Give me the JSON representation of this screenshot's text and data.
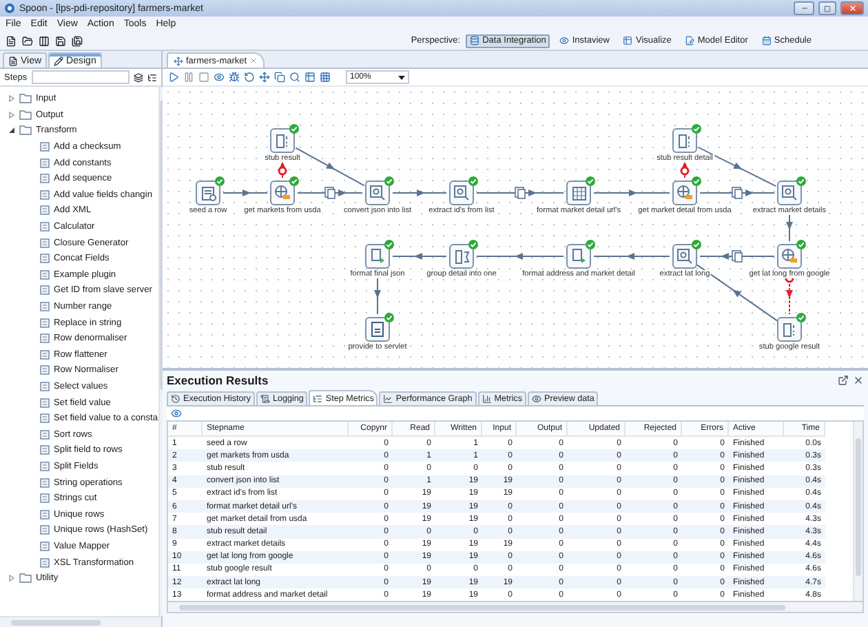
{
  "window": {
    "title": "Spoon - [lps-pdi-repository] farmers-market"
  },
  "menu": [
    "File",
    "Edit",
    "View",
    "Action",
    "Tools",
    "Help"
  ],
  "perspective": {
    "label": "Perspective:",
    "items": [
      {
        "label": "Data Integration",
        "selected": true
      },
      {
        "label": "Instaview",
        "selected": false
      },
      {
        "label": "Visualize",
        "selected": false
      },
      {
        "label": "Model Editor",
        "selected": false
      },
      {
        "label": "Schedule",
        "selected": false
      }
    ]
  },
  "left_tabs": [
    {
      "label": "View",
      "selected": false
    },
    {
      "label": "Design",
      "selected": true
    }
  ],
  "steps_search": {
    "label": "Steps"
  },
  "tree": [
    {
      "label": "Input",
      "expanded": false
    },
    {
      "label": "Output",
      "expanded": false
    },
    {
      "label": "Transform",
      "expanded": true,
      "children": [
        {
          "label": "Add a checksum"
        },
        {
          "label": "Add constants"
        },
        {
          "label": "Add sequence"
        },
        {
          "label": "Add value fields changin"
        },
        {
          "label": "Add XML"
        },
        {
          "label": "Calculator"
        },
        {
          "label": "Closure Generator"
        },
        {
          "label": "Concat Fields"
        },
        {
          "label": "Example plugin"
        },
        {
          "label": "Get ID from slave server"
        },
        {
          "label": "Number range"
        },
        {
          "label": "Replace in string"
        },
        {
          "label": "Row denormaliser"
        },
        {
          "label": "Row flattener"
        },
        {
          "label": "Row Normaliser"
        },
        {
          "label": "Select values"
        },
        {
          "label": "Set field value"
        },
        {
          "label": "Set field value to a consta"
        },
        {
          "label": "Sort rows"
        },
        {
          "label": "Split field to rows"
        },
        {
          "label": "Split Fields"
        },
        {
          "label": "String operations"
        },
        {
          "label": "Strings cut"
        },
        {
          "label": "Unique rows"
        },
        {
          "label": "Unique rows (HashSet)"
        },
        {
          "label": "Value Mapper"
        },
        {
          "label": "XSL Transformation"
        }
      ]
    },
    {
      "label": "Utility",
      "expanded": false
    }
  ],
  "editor_tab": {
    "label": "farmers-market"
  },
  "zoom": {
    "value": "100%"
  },
  "canvas": {
    "nodes": [
      {
        "label": "stub result",
        "kind": "dummy",
        "finished": true
      },
      {
        "label": "stub result detail",
        "kind": "dummy",
        "finished": true
      },
      {
        "label": "seed a row",
        "kind": "generator",
        "finished": true
      },
      {
        "label": "get markets from usda",
        "kind": "http",
        "finished": true
      },
      {
        "label": "convert json into list",
        "kind": "json",
        "finished": true
      },
      {
        "label": "extract id's from list",
        "kind": "json",
        "finished": true
      },
      {
        "label": "format market detail url's",
        "kind": "calculator",
        "finished": true
      },
      {
        "label": "get market detail from usda",
        "kind": "http",
        "finished": true
      },
      {
        "label": "extract market details",
        "kind": "json",
        "finished": true
      },
      {
        "label": "format final json",
        "kind": "script",
        "finished": true
      },
      {
        "label": "group detail into one",
        "kind": "group",
        "finished": true
      },
      {
        "label": "format address and market detail",
        "kind": "script",
        "finished": true
      },
      {
        "label": "extract lat long",
        "kind": "json",
        "finished": true
      },
      {
        "label": "get lat long from google",
        "kind": "http",
        "finished": true
      },
      {
        "label": "provide to servlet",
        "kind": "output",
        "finished": true
      },
      {
        "label": "stub google result",
        "kind": "dummy",
        "finished": true
      }
    ]
  },
  "results": {
    "title": "Execution Results",
    "tabs": [
      {
        "label": "Execution History",
        "selected": false
      },
      {
        "label": "Logging",
        "selected": false
      },
      {
        "label": "Step Metrics",
        "selected": true
      },
      {
        "label": "Performance Graph",
        "selected": false
      },
      {
        "label": "Metrics",
        "selected": false
      },
      {
        "label": "Preview data",
        "selected": false
      }
    ],
    "columns": [
      "#",
      "Stepname",
      "Copynr",
      "Read",
      "Written",
      "Input",
      "Output",
      "Updated",
      "Rejected",
      "Errors",
      "Active",
      "Time"
    ],
    "rows": [
      [
        "1",
        "seed a row",
        "0",
        "0",
        "1",
        "0",
        "0",
        "0",
        "0",
        "0",
        "Finished",
        "0.0s"
      ],
      [
        "2",
        "get markets from usda",
        "0",
        "1",
        "1",
        "0",
        "0",
        "0",
        "0",
        "0",
        "Finished",
        "0.3s"
      ],
      [
        "3",
        "stub result",
        "0",
        "0",
        "0",
        "0",
        "0",
        "0",
        "0",
        "0",
        "Finished",
        "0.3s"
      ],
      [
        "4",
        "convert json into list",
        "0",
        "1",
        "19",
        "19",
        "0",
        "0",
        "0",
        "0",
        "Finished",
        "0.4s"
      ],
      [
        "5",
        "extract id's from list",
        "0",
        "19",
        "19",
        "19",
        "0",
        "0",
        "0",
        "0",
        "Finished",
        "0.4s"
      ],
      [
        "6",
        "format market detail url's",
        "0",
        "19",
        "19",
        "0",
        "0",
        "0",
        "0",
        "0",
        "Finished",
        "0.4s"
      ],
      [
        "7",
        "get market detail from usda",
        "0",
        "19",
        "19",
        "0",
        "0",
        "0",
        "0",
        "0",
        "Finished",
        "4.3s"
      ],
      [
        "8",
        "stub result detail",
        "0",
        "0",
        "0",
        "0",
        "0",
        "0",
        "0",
        "0",
        "Finished",
        "4.3s"
      ],
      [
        "9",
        "extract market details",
        "0",
        "19",
        "19",
        "19",
        "0",
        "0",
        "0",
        "0",
        "Finished",
        "4.4s"
      ],
      [
        "10",
        "get lat long from google",
        "0",
        "19",
        "19",
        "0",
        "0",
        "0",
        "0",
        "0",
        "Finished",
        "4.6s"
      ],
      [
        "11",
        "stub google result",
        "0",
        "0",
        "0",
        "0",
        "0",
        "0",
        "0",
        "0",
        "Finished",
        "4.6s"
      ],
      [
        "12",
        "extract lat long",
        "0",
        "19",
        "19",
        "19",
        "0",
        "0",
        "0",
        "0",
        "Finished",
        "4.7s"
      ],
      [
        "13",
        "format address and market detail",
        "0",
        "19",
        "19",
        "0",
        "0",
        "0",
        "0",
        "0",
        "Finished",
        "4.8s"
      ]
    ]
  }
}
